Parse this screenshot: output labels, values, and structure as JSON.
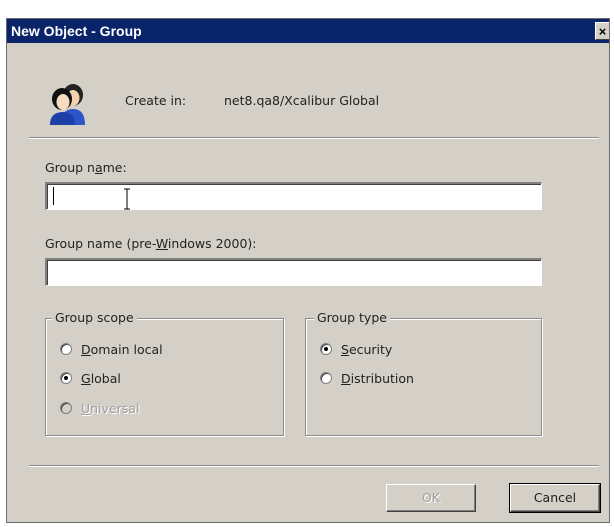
{
  "window": {
    "title": "New Object - Group",
    "close_symbol": "×"
  },
  "header": {
    "icon": "group-users-icon",
    "create_in_label": "Create in:",
    "create_in_path": "net8.qa8/Xcalibur Global"
  },
  "fields": {
    "group_name_label": "Group name:",
    "group_name_value": "",
    "pre2000_label": "Group name (pre-Windows 2000):",
    "pre2000_value": ""
  },
  "group_scope": {
    "legend": "Group scope",
    "options": [
      {
        "label": "Domain local",
        "checked": false,
        "disabled": false
      },
      {
        "label": "Global",
        "checked": true,
        "disabled": false
      },
      {
        "label": "Universal",
        "checked": false,
        "disabled": true
      }
    ]
  },
  "group_type": {
    "legend": "Group type",
    "options": [
      {
        "label": "Security",
        "checked": true,
        "disabled": false
      },
      {
        "label": "Distribution",
        "checked": false,
        "disabled": false
      }
    ]
  },
  "buttons": {
    "ok_label": "OK",
    "cancel_label": "Cancel",
    "ok_disabled": true
  },
  "colors": {
    "titlebar": "#0a246a",
    "dialog_bg": "#d4d0c8"
  }
}
